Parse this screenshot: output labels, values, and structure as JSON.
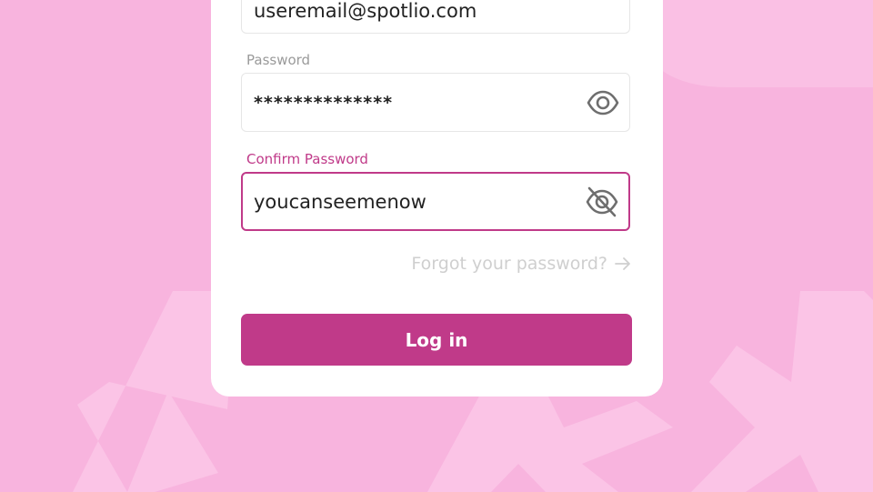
{
  "colors": {
    "background": "#f8b4de",
    "accent": "#c03a89",
    "card": "#ffffff"
  },
  "login_form": {
    "email_value": "useremail@spotlio.com",
    "password_label": "Password",
    "password_value": "**************",
    "confirm_label": "Confirm Password",
    "confirm_value": "youcanseemenow",
    "forgot_link": "Forgot your password?",
    "login_button": "Log in"
  },
  "icons": {
    "password_toggle": "eye-icon",
    "confirm_toggle": "eye-off-icon",
    "forgot_arrow": "arrow-right-icon"
  }
}
